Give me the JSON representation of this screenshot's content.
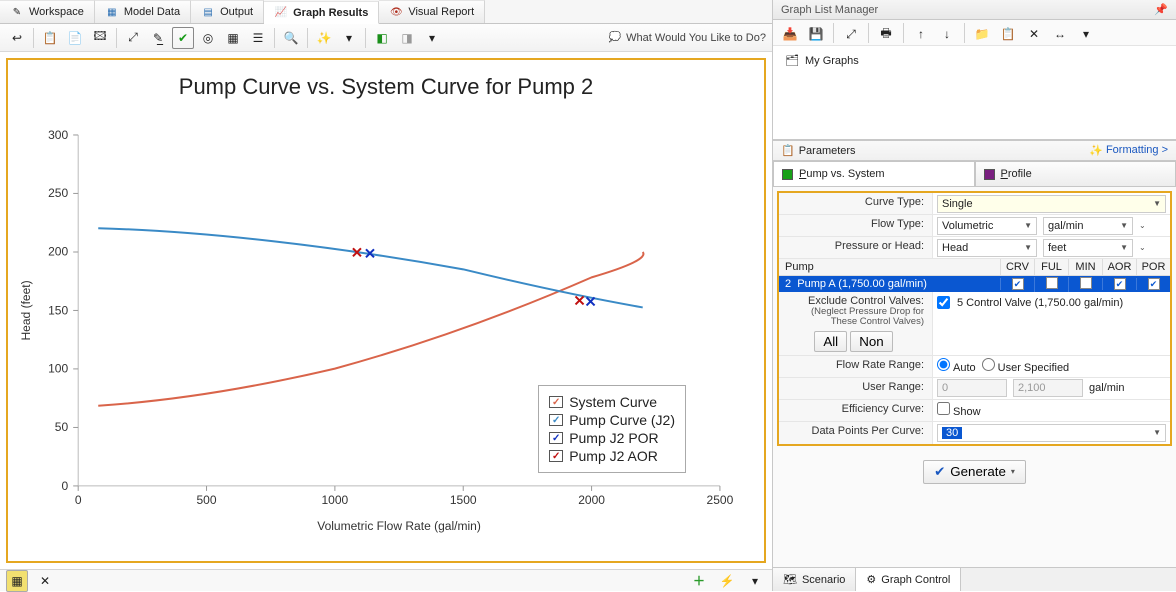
{
  "tabs": {
    "workspace": "Workspace",
    "model_data": "Model Data",
    "output": "Output",
    "graph_results": "Graph Results",
    "visual_report": "Visual Report"
  },
  "toolbar": {
    "help_link": "What Would You Like to Do?"
  },
  "chart": {
    "title": "Pump Curve vs. System Curve for Pump 2",
    "y_label": "Head (feet)",
    "x_label": "Volumetric Flow Rate (gal/min)",
    "legend": {
      "system": "System Curve",
      "pump_curve": "Pump Curve (J2)",
      "por": "Pump J2 POR",
      "aor": "Pump J2 AOR"
    },
    "x_ticks": [
      "0",
      "500",
      "1000",
      "1500",
      "2000",
      "2500"
    ],
    "y_ticks": [
      "0",
      "50",
      "100",
      "150",
      "200",
      "250",
      "300"
    ]
  },
  "chart_data": {
    "type": "line",
    "xlabel": "Volumetric Flow Rate (gal/min)",
    "ylabel": "Head (feet)",
    "xlim": [
      0,
      2500
    ],
    "ylim": [
      0,
      300
    ],
    "series": [
      {
        "name": "System Curve",
        "color": "#d9644a",
        "x": [
          80,
          500,
          1000,
          1500,
          2000,
          2200
        ],
        "y": [
          68,
          77,
          100,
          135,
          178,
          200
        ]
      },
      {
        "name": "Pump Curve (J2)",
        "color": "#3a8ac6",
        "x": [
          80,
          500,
          1000,
          1500,
          2000,
          2200
        ],
        "y": [
          220,
          217,
          205,
          185,
          160,
          152
        ]
      }
    ],
    "markers": [
      {
        "name": "Pump J2 POR",
        "color": "#1030c0",
        "points": [
          [
            1120,
            198
          ],
          [
            1980,
            157
          ]
        ]
      },
      {
        "name": "Pump J2 AOR",
        "color": "#c01010",
        "points": [
          [
            1080,
            199
          ],
          [
            1950,
            158
          ]
        ]
      }
    ]
  },
  "glm": {
    "title": "Graph List Manager",
    "root": "My Graphs"
  },
  "params": {
    "title": "Parameters",
    "formatting": "Formatting >",
    "tab_pvs": "Pump vs. System",
    "tab_profile": "Profile",
    "curve_type_label": "Curve Type:",
    "curve_type": "Single",
    "flow_type_label": "Flow Type:",
    "flow_type": "Volumetric",
    "flow_unit": "gal/min",
    "press_label": "Pressure or Head:",
    "press_val": "Head",
    "press_unit": "feet",
    "pump_header": "Pump",
    "cols": {
      "crv": "CRV",
      "ful": "FUL",
      "min": "MIN",
      "aor": "AOR",
      "por": "POR"
    },
    "pump_row_id": "2",
    "pump_row": "Pump A  (1,750.00 gal/min)",
    "exclude_label": "Exclude Control Valves:",
    "exclude_note": "(Neglect Pressure Drop for These Control Valves)",
    "all_btn": "All",
    "non_btn": "Non",
    "exclude_item": "5  Control Valve  (1,750.00 gal/min)",
    "flow_range_label": "Flow Rate Range:",
    "auto": "Auto",
    "user_spec": "User Specified",
    "user_range_label": "User Range:",
    "range_lo": "0",
    "range_hi": "2,100",
    "range_unit": "gal/min",
    "eff_label": "Efficiency Curve:",
    "eff_show": "Show",
    "dppc_label": "Data Points Per Curve:",
    "dppc_val": "30",
    "generate": "Generate"
  },
  "btabs": {
    "scenario": "Scenario",
    "graph_control": "Graph Control"
  }
}
